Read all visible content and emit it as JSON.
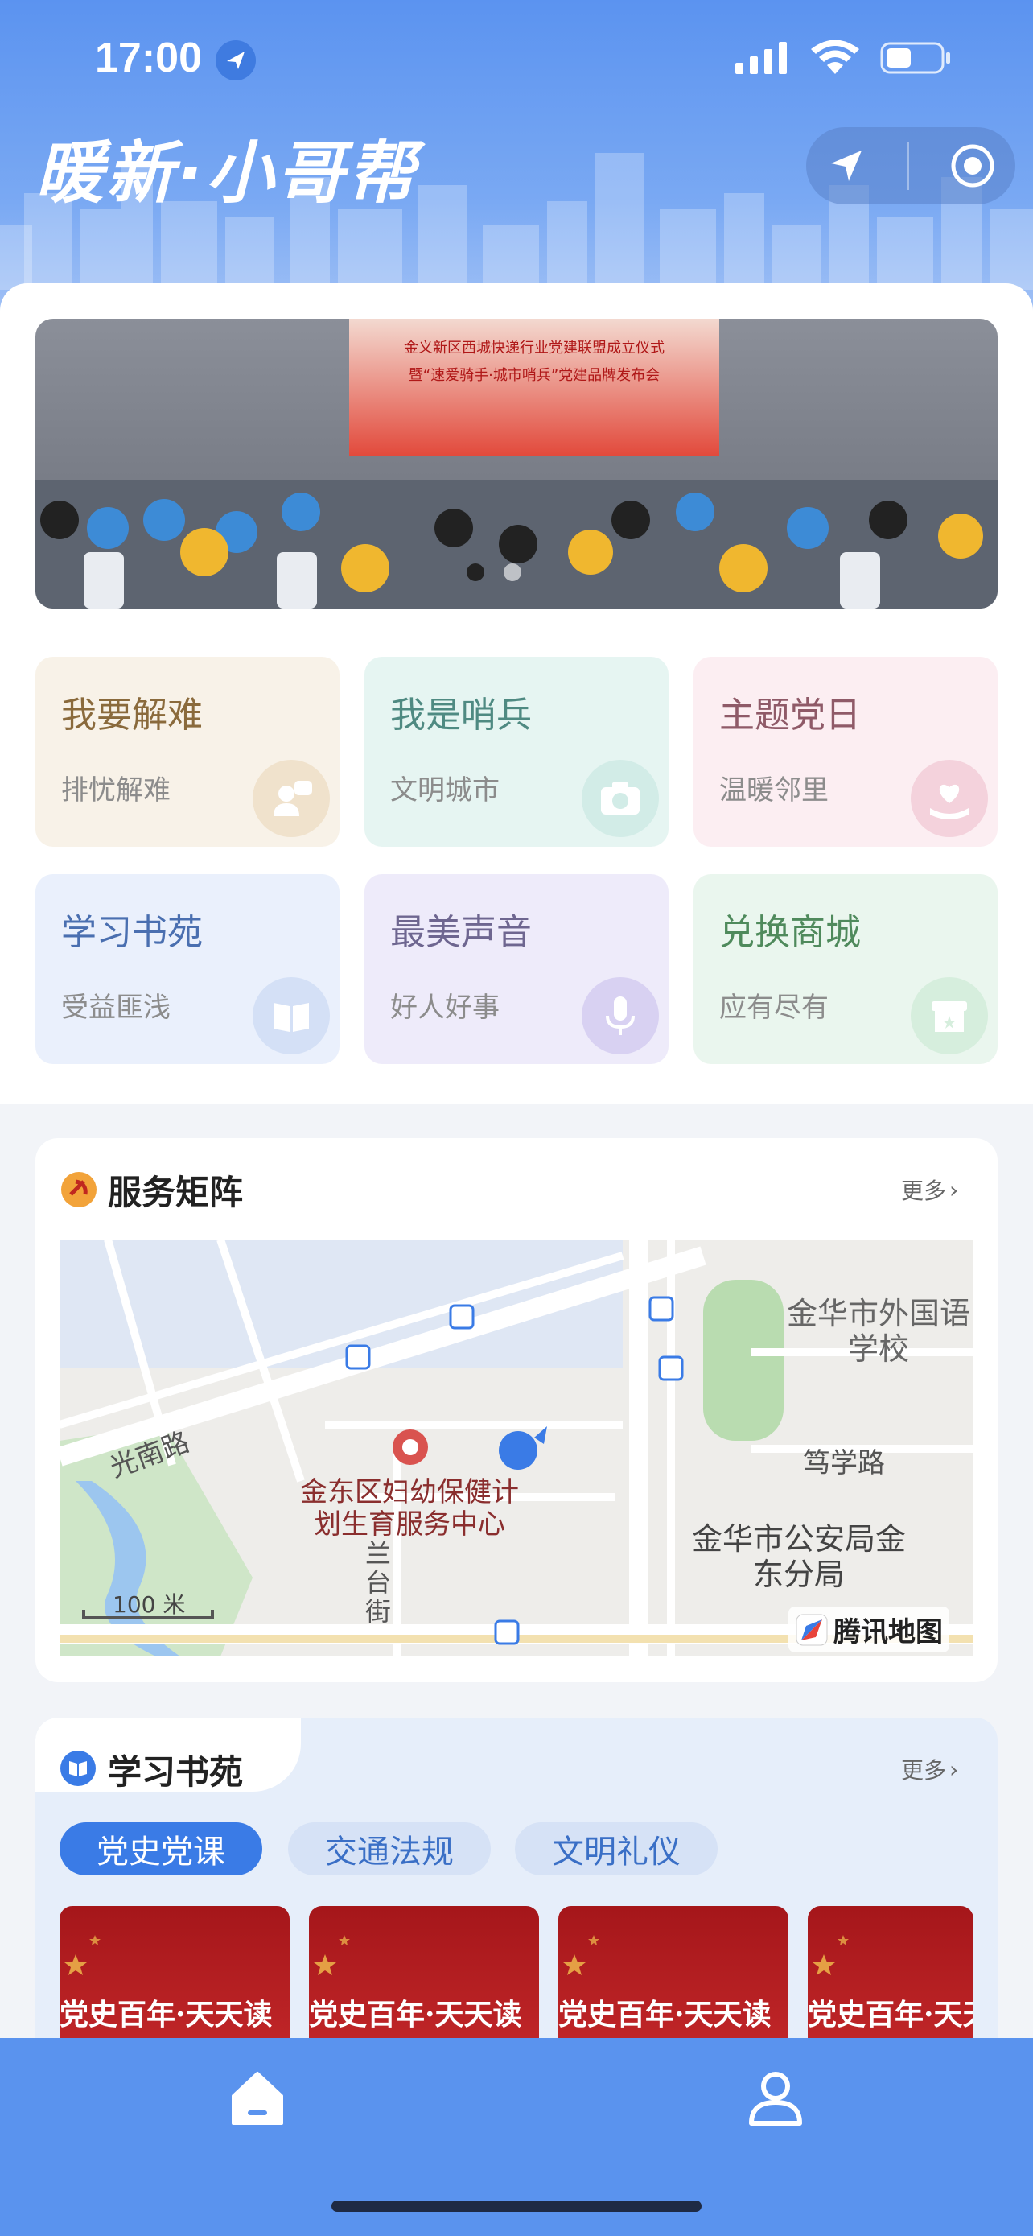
{
  "status_bar": {
    "time": "17:00"
  },
  "header": {
    "app_title": "暖新·小哥帮"
  },
  "banner": {
    "stage_line1": "金义新区西城快递行业党建联盟成立仪式",
    "stage_line2": "暨“速爱骑手·城市哨兵”党建品牌发布会",
    "slide_count": 2,
    "active_slide": 1
  },
  "tiles": [
    {
      "title": "我要解难",
      "subtitle": "排忧解难",
      "icon": "chat-person-icon",
      "bg": "#f8f2e8",
      "title_color": "#8a6a3c",
      "icon_bg": "#f0e2cc"
    },
    {
      "title": "我是哨兵",
      "subtitle": "文明城市",
      "icon": "camera-icon",
      "bg": "#e6f5f2",
      "title_color": "#4f8a82",
      "icon_bg": "#d2ece7"
    },
    {
      "title": "主题党日",
      "subtitle": "温暖邻里",
      "icon": "heart-hand-icon",
      "bg": "#fceef2",
      "title_color": "#8f5a68",
      "icon_bg": "#f4d2dc"
    },
    {
      "title": "学习书苑",
      "subtitle": "受益匪浅",
      "icon": "book-icon",
      "bg": "#eaf0fc",
      "title_color": "#4a6fb0",
      "icon_bg": "#d4e0f6"
    },
    {
      "title": "最美声音",
      "subtitle": "好人好事",
      "icon": "microphone-icon",
      "bg": "#eeebfa",
      "title_color": "#6e6690",
      "icon_bg": "#d8d1f2"
    },
    {
      "title": "兑换商城",
      "subtitle": "应有尽有",
      "icon": "store-icon",
      "bg": "#eaf6ee",
      "title_color": "#4f8a5c",
      "icon_bg": "#d6eedd"
    }
  ],
  "service_matrix": {
    "title": "服务矩阵",
    "more": "更多",
    "map": {
      "labels": {
        "road_guangnan": "光南路",
        "road_dushue": "笃学路",
        "road_lantai": "兰台街",
        "school": "金华市外国语学校",
        "hospital": "金东区妇幼保健计划生育服务中心",
        "police": "金华市公安局金东分局",
        "scale": "100 米",
        "provider": "腾讯地图"
      }
    }
  },
  "study": {
    "title": "学习书苑",
    "more": "更多",
    "tabs": [
      "党史党课",
      "交通法规",
      "文明礼仪"
    ],
    "active_tab": 0,
    "books": [
      "党史百年·天天读",
      "党史百年·天天读",
      "党史百年·天天读",
      "党史百年·天天读"
    ]
  },
  "tabbar": {
    "items": [
      "home-icon",
      "profile-icon"
    ]
  },
  "colors": {
    "primary": "#3a7be6",
    "header": "#5b93f0"
  }
}
